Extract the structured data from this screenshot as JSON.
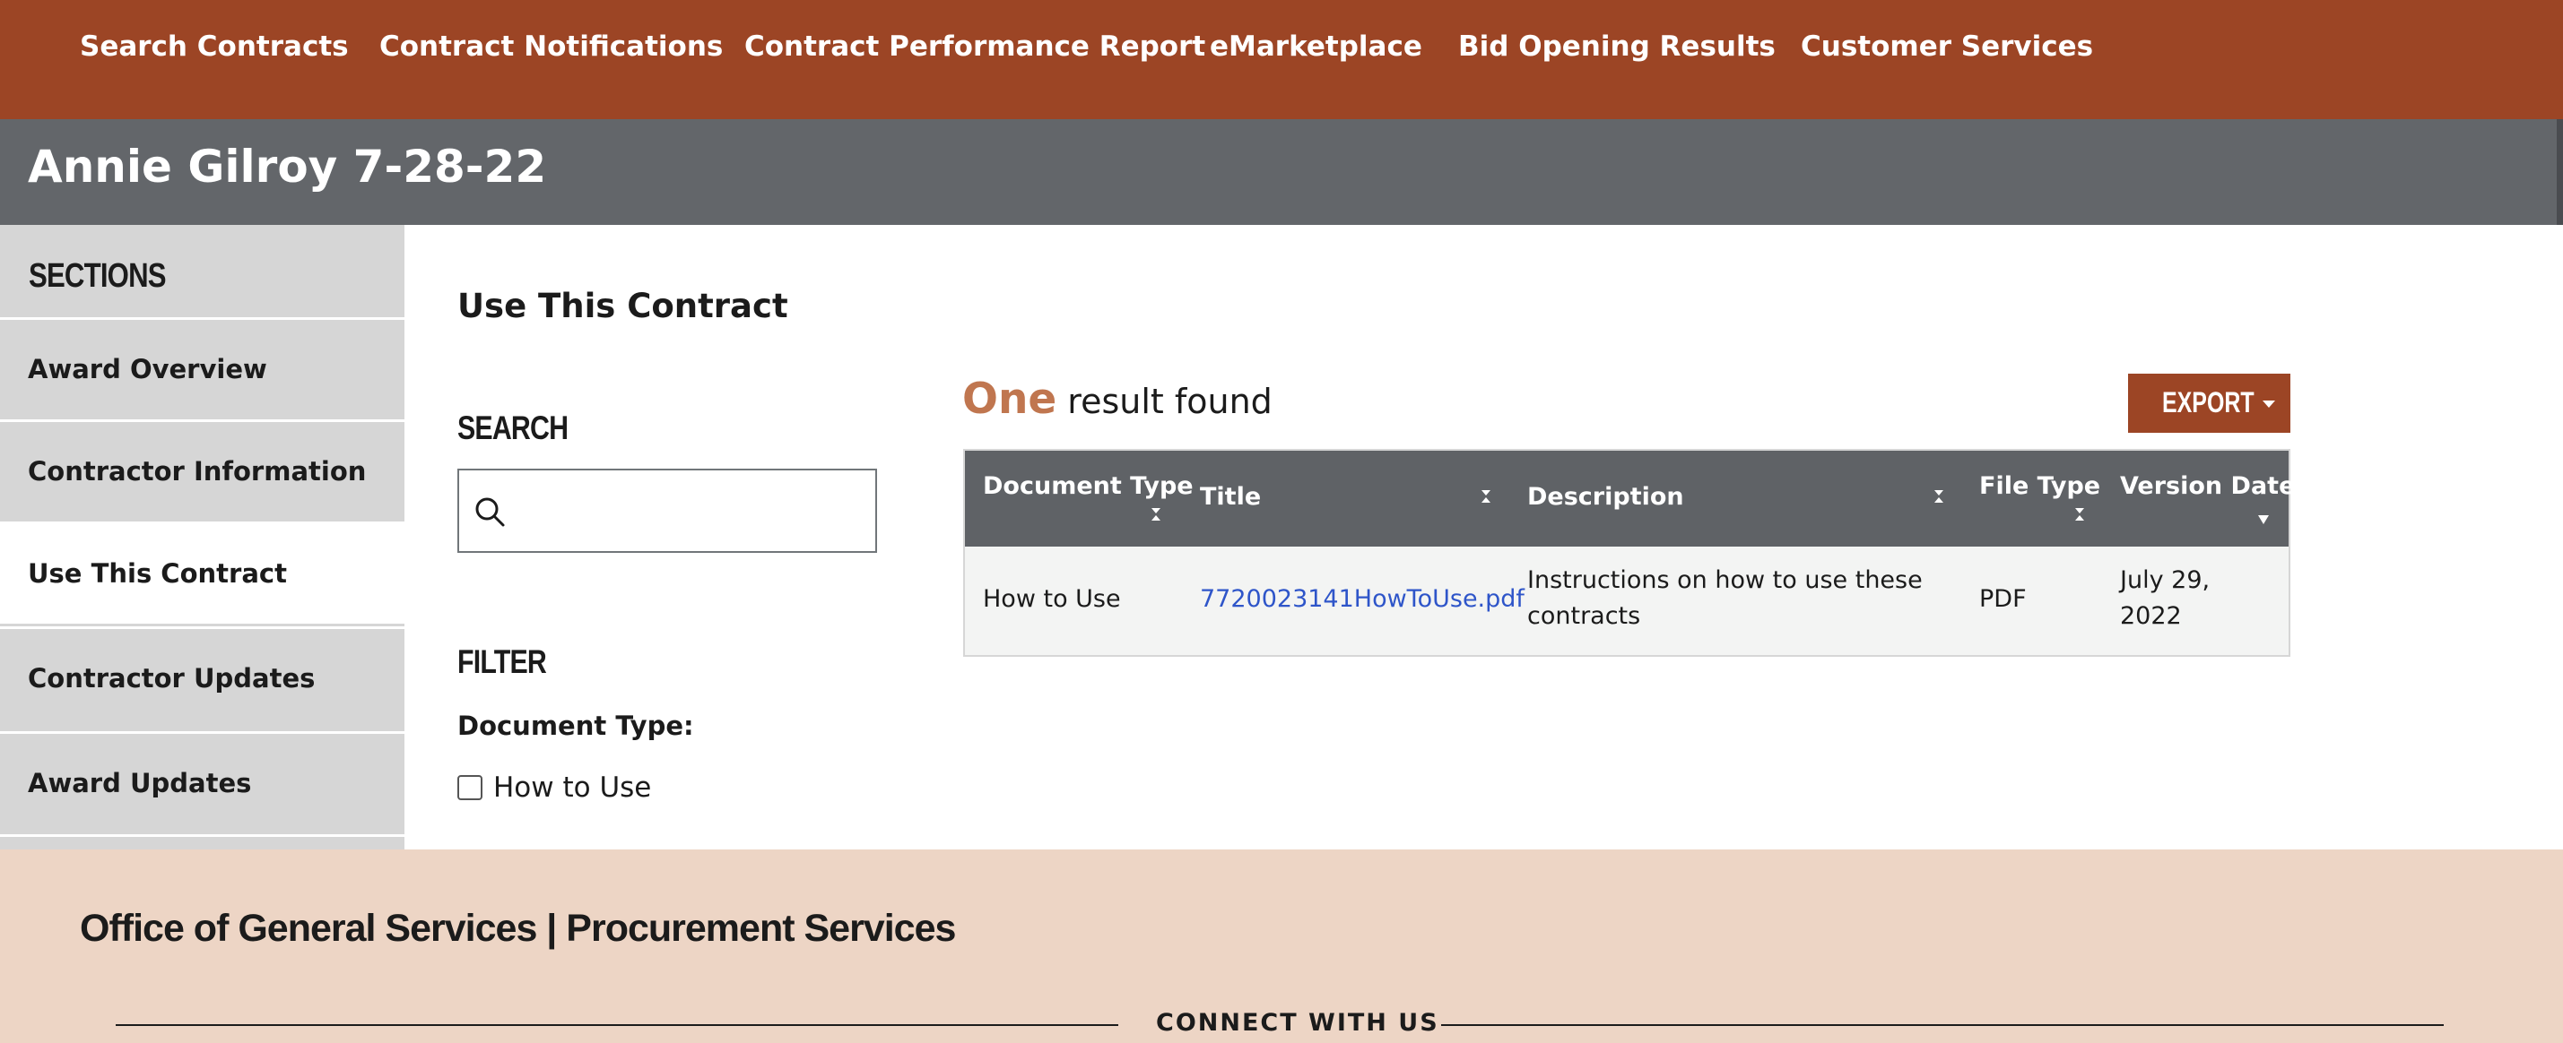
{
  "nav": {
    "items": [
      {
        "label": "Search Contracts"
      },
      {
        "label": "Contract Notifications"
      },
      {
        "label": "Contract Performance Report"
      },
      {
        "label": "eMarketplace"
      },
      {
        "label": "Bid Opening Results"
      },
      {
        "label": "Customer Services"
      }
    ]
  },
  "page": {
    "title": "Annie Gilroy 7-28-22"
  },
  "sidebar": {
    "heading": "SECTIONS",
    "items": [
      {
        "label": "Award Overview"
      },
      {
        "label": "Contractor Information"
      },
      {
        "label": "Use This Contract",
        "active": true
      },
      {
        "label": "Contractor Updates"
      },
      {
        "label": "Award Updates"
      }
    ]
  },
  "main": {
    "title": "Use This Contract",
    "search": {
      "heading": "SEARCH",
      "value": "",
      "icon": "search-icon"
    },
    "filter": {
      "heading": "FILTER",
      "label": "Document Type:",
      "options": [
        {
          "label": "How to Use",
          "checked": false
        }
      ]
    },
    "results": {
      "count_word": "One",
      "text": "result found"
    },
    "export": {
      "label": "EXPORT"
    },
    "table": {
      "columns": [
        "Document Type",
        "Title",
        "Description",
        "File Type",
        "Version Date"
      ],
      "rows": [
        {
          "document_type": "How to Use",
          "title": "7720023141HowToUse.pdf",
          "description": "Instructions on how to use these contracts",
          "file_type": "PDF",
          "version_date": "July 29, 2022"
        }
      ]
    }
  },
  "footer": {
    "org": "Office of General Services | Procurement Services",
    "connect": "CONNECT WITH US"
  },
  "colors": {
    "brand": "#9c4525",
    "title_bar": "#63666a",
    "sidebar": "#d6d6d6",
    "accent_count": "#c0764f",
    "link": "#2e55c9",
    "footer": "#edd5c5"
  }
}
